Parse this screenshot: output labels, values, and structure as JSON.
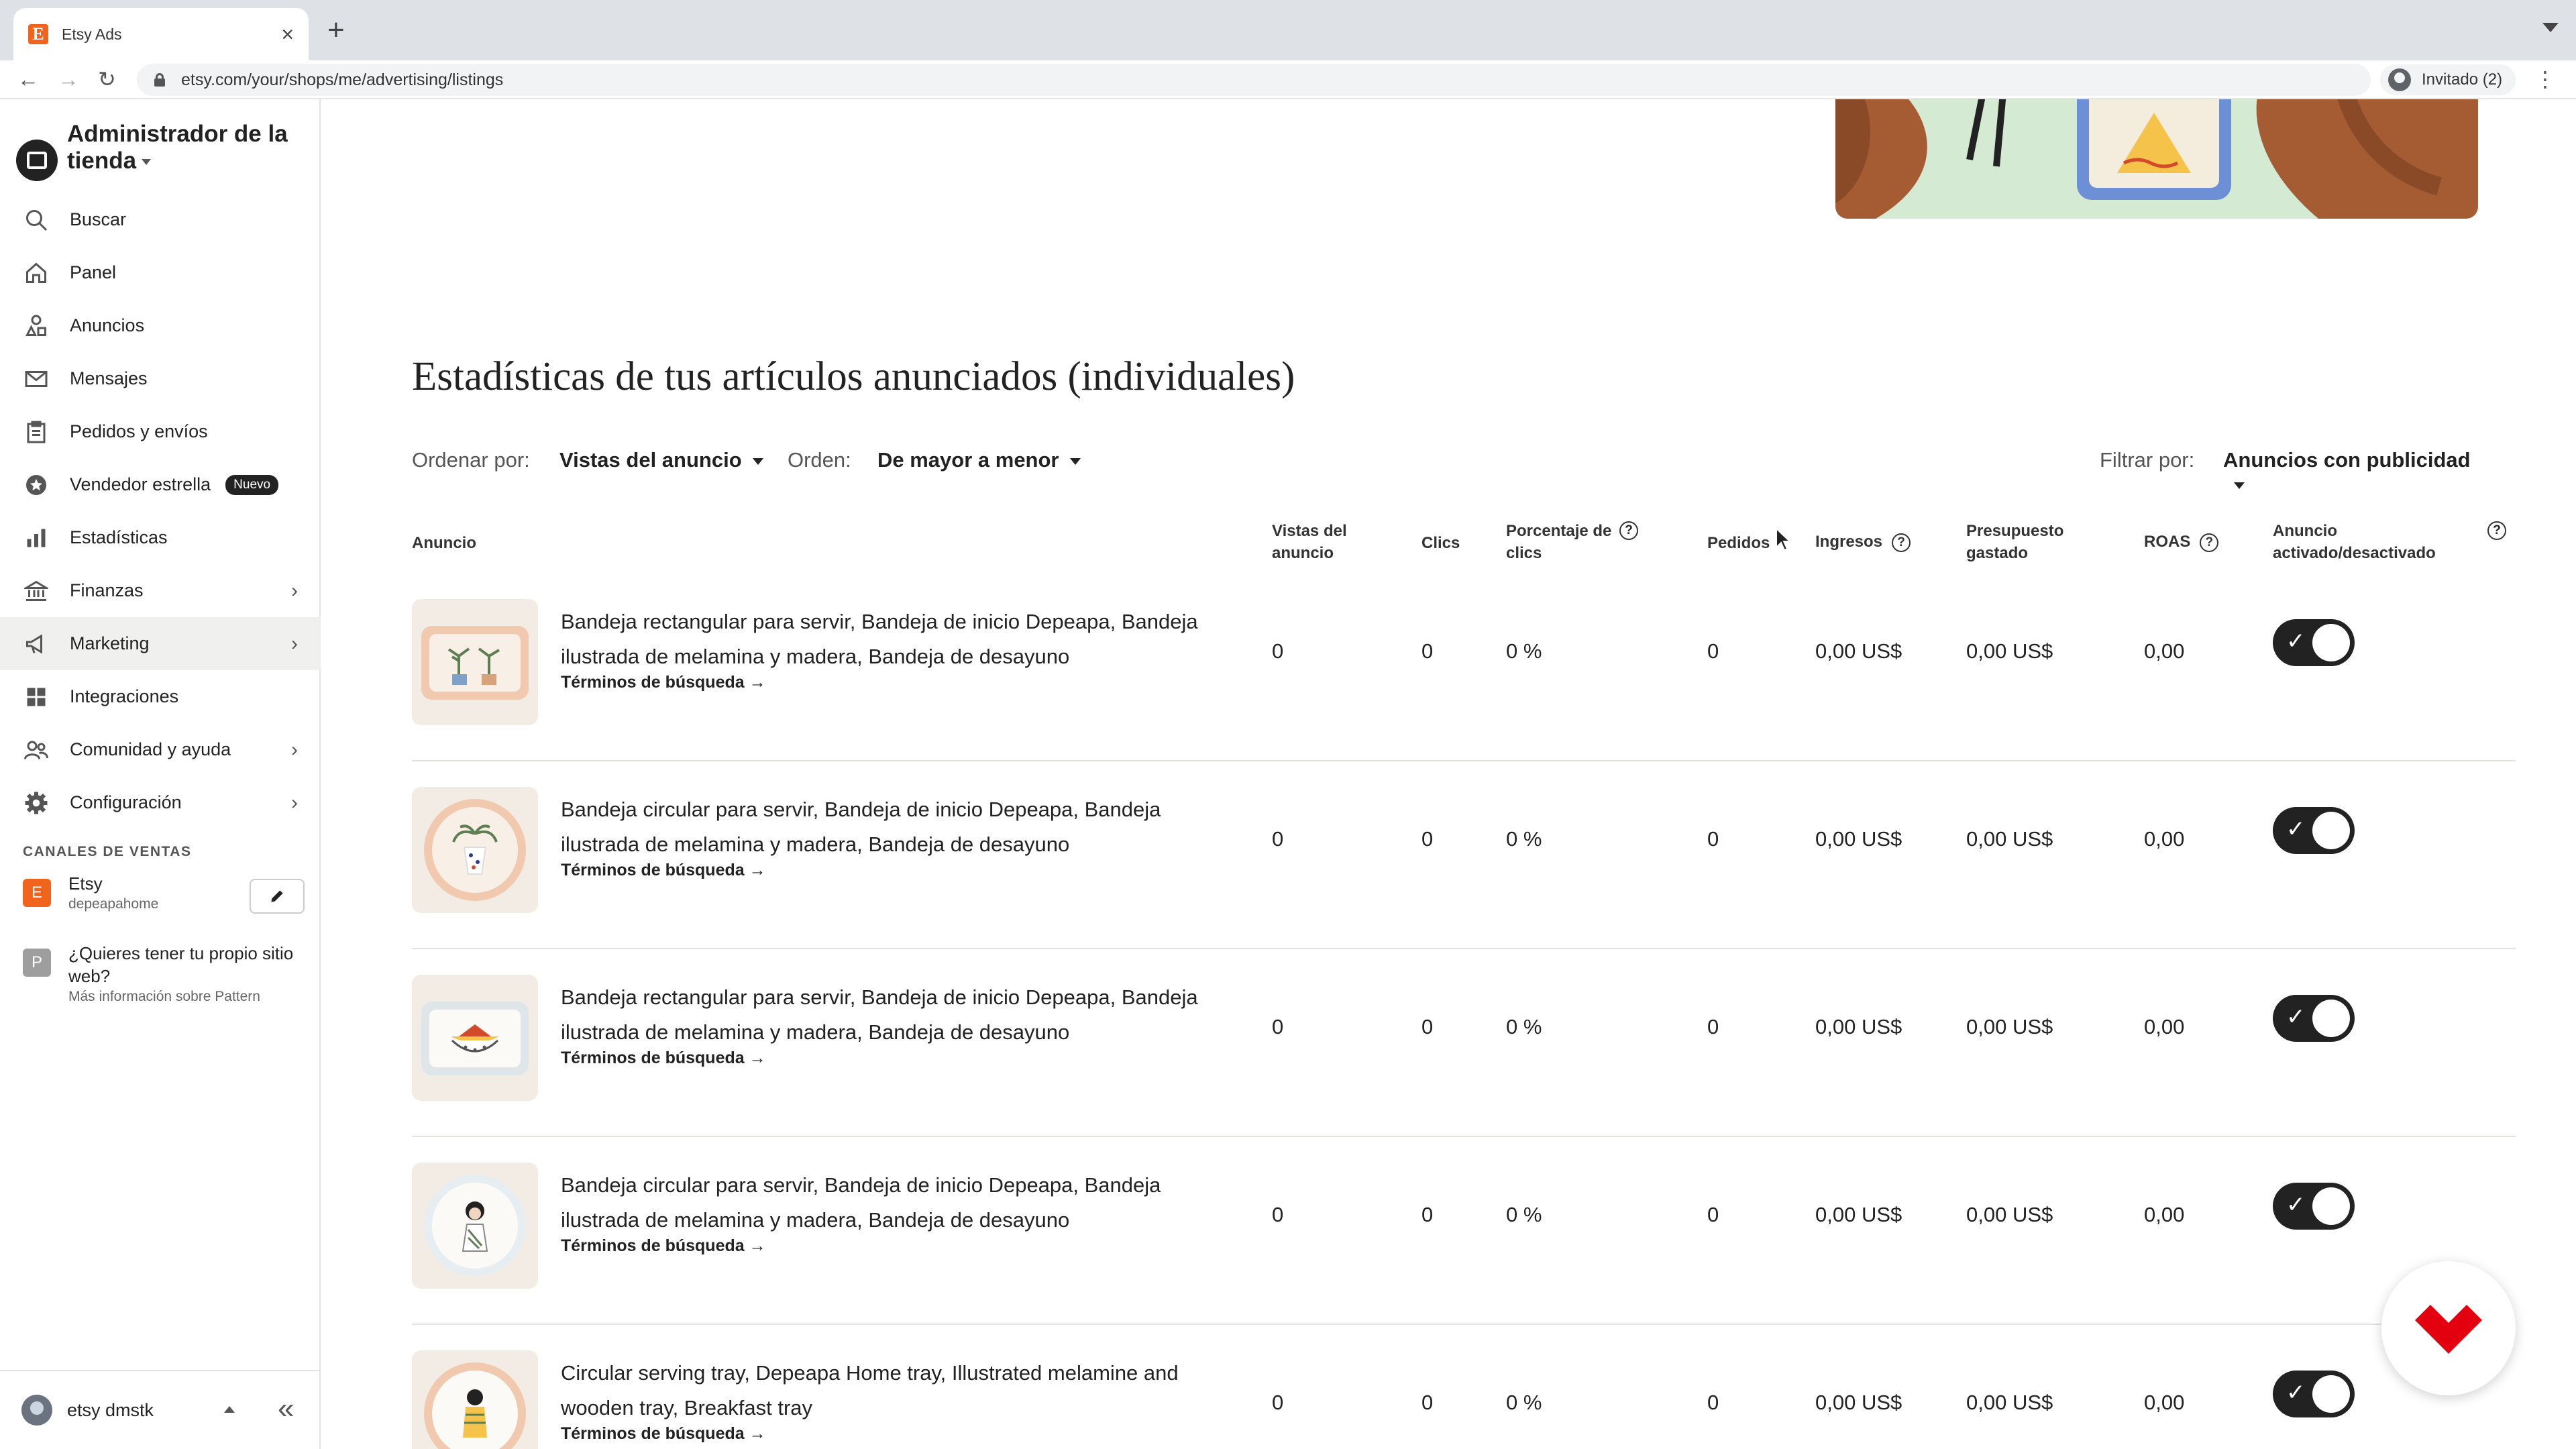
{
  "browser": {
    "tab_title": "Etsy Ads",
    "favicon_letter": "E",
    "url": "etsy.com/your/shops/me/advertising/listings",
    "profile_label": "Invitado (2)"
  },
  "sidebar": {
    "shop_title": "Administrador de la tienda",
    "items": [
      {
        "label": "Buscar",
        "icon": "search-icon"
      },
      {
        "label": "Panel",
        "icon": "home-icon"
      },
      {
        "label": "Anuncios",
        "icon": "shapes-icon"
      },
      {
        "label": "Mensajes",
        "icon": "mail-icon"
      },
      {
        "label": "Pedidos y envíos",
        "icon": "clipboard-icon"
      },
      {
        "label": "Vendedor estrella",
        "icon": "star-badge-icon",
        "badge": "Nuevo"
      },
      {
        "label": "Estadísticas",
        "icon": "bar-chart-icon"
      },
      {
        "label": "Finanzas",
        "icon": "bank-icon"
      },
      {
        "label": "Marketing",
        "icon": "megaphone-icon"
      },
      {
        "label": "Integraciones",
        "icon": "grid-icon"
      },
      {
        "label": "Comunidad y ayuda",
        "icon": "people-icon"
      },
      {
        "label": "Configuración",
        "icon": "gear-icon"
      }
    ],
    "channels_title": "CANALES DE VENTAS",
    "channels": [
      {
        "letter": "E",
        "name": "Etsy",
        "sub": "depeapahome",
        "color": "#f1641e"
      },
      {
        "letter": "P",
        "name": "¿Quieres tener tu propio sitio web?",
        "sub": "Más información sobre Pattern",
        "color": "#9e9e9e"
      }
    ],
    "user_name": "etsy dmstk"
  },
  "main": {
    "section_title": "Estadísticas de tus artículos anunciados (individuales)",
    "sort_label": "Ordenar por:",
    "sort_value": "Vistas del anuncio",
    "order_label": "Orden:",
    "order_value": "De mayor a menor",
    "filter_label": "Filtrar por:",
    "filter_value": "Anuncios con publicidad"
  },
  "table": {
    "headers": {
      "listing": "Anuncio",
      "views": "Vistas del anuncio",
      "clicks": "Clics",
      "ctr": "Porcentaje de clics",
      "orders": "Pedidos",
      "revenue": "Ingresos",
      "spend": "Presupuesto gastado",
      "roas": "ROAS",
      "status": "Anuncio activado/desactivado"
    },
    "link_label": "Términos de búsqueda",
    "rows": [
      {
        "title": "Bandeja rectangular para servir, Bandeja de inicio Depeapa, Bandeja ilustrada de melamina y madera, Bandeja de desayuno",
        "views": "0",
        "clicks": "0",
        "ctr": "0 %",
        "orders": "0",
        "revenue": "0,00 US$",
        "spend": "0,00 US$",
        "roas": "0,00",
        "active": true
      },
      {
        "title": "Bandeja circular para servir, Bandeja de inicio Depeapa, Bandeja ilustrada de melamina y madera, Bandeja de desayuno",
        "views": "0",
        "clicks": "0",
        "ctr": "0 %",
        "orders": "0",
        "revenue": "0,00 US$",
        "spend": "0,00 US$",
        "roas": "0,00",
        "active": true
      },
      {
        "title": "Bandeja rectangular para servir, Bandeja de inicio Depeapa, Bandeja ilustrada de melamina y madera, Bandeja de desayuno",
        "views": "0",
        "clicks": "0",
        "ctr": "0 %",
        "orders": "0",
        "revenue": "0,00 US$",
        "spend": "0,00 US$",
        "roas": "0,00",
        "active": true
      },
      {
        "title": "Bandeja circular para servir, Bandeja de inicio Depeapa, Bandeja ilustrada de melamina y madera, Bandeja de desayuno",
        "views": "0",
        "clicks": "0",
        "ctr": "0 %",
        "orders": "0",
        "revenue": "0,00 US$",
        "spend": "0,00 US$",
        "roas": "0,00",
        "active": true
      },
      {
        "title": "Circular serving tray, Depeapa Home tray, Illustrated melamine and wooden tray, Breakfast tray",
        "views": "0",
        "clicks": "0",
        "ctr": "0 %",
        "orders": "0",
        "revenue": "0,00 US$",
        "spend": "0,00 US$",
        "roas": "0,00",
        "active": true
      }
    ]
  },
  "colors": {
    "accent_dark": "#222222",
    "etsy_orange": "#f1641e",
    "fab_logo": "#e3000f",
    "hero_bg": "#d4ead3"
  }
}
